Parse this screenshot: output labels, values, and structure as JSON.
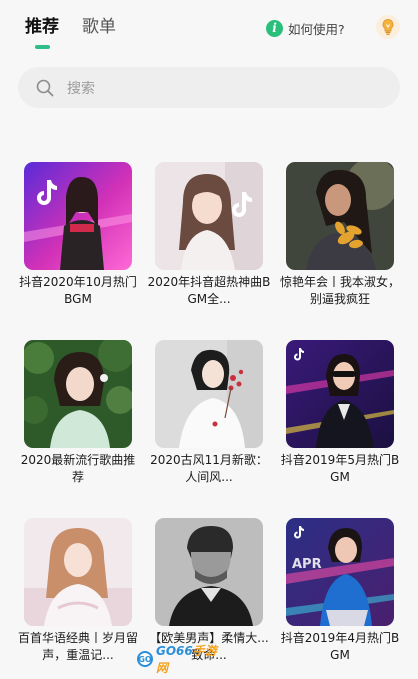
{
  "header": {
    "tabs": [
      {
        "label": "推荐",
        "active": true
      },
      {
        "label": "歌单",
        "active": false
      }
    ],
    "help_label": "如何使用?",
    "accent_color": "#2dbe8a"
  },
  "search": {
    "placeholder": "搜索"
  },
  "playlists": [
    {
      "title": "抖音2020年10月热门BGM",
      "theme": "pink-neon"
    },
    {
      "title": "2020年抖音超热神曲BGM全...",
      "theme": "soft-portrait"
    },
    {
      "title": "惊艳年会丨我本淑女，别逼我疯狂",
      "theme": "autumn-leaves"
    },
    {
      "title": "2020最新流行歌曲推荐",
      "theme": "green-garden"
    },
    {
      "title": "2020古风11月新歌：人间风...",
      "theme": "white-hanfu"
    },
    {
      "title": "抖音2019年5月热门BGM",
      "theme": "neon-stage"
    },
    {
      "title": "百首华语经典丨岁月留声，重温记...",
      "theme": "pastel-room"
    },
    {
      "title": "【欧美男声】柔情大...致命...",
      "theme": "mono-portrait"
    },
    {
      "title": "抖音2019年4月热门BGM",
      "theme": "april-neon"
    }
  ],
  "watermark": {
    "badge": "GO",
    "text": "GO66",
    "accent": "手游网"
  }
}
